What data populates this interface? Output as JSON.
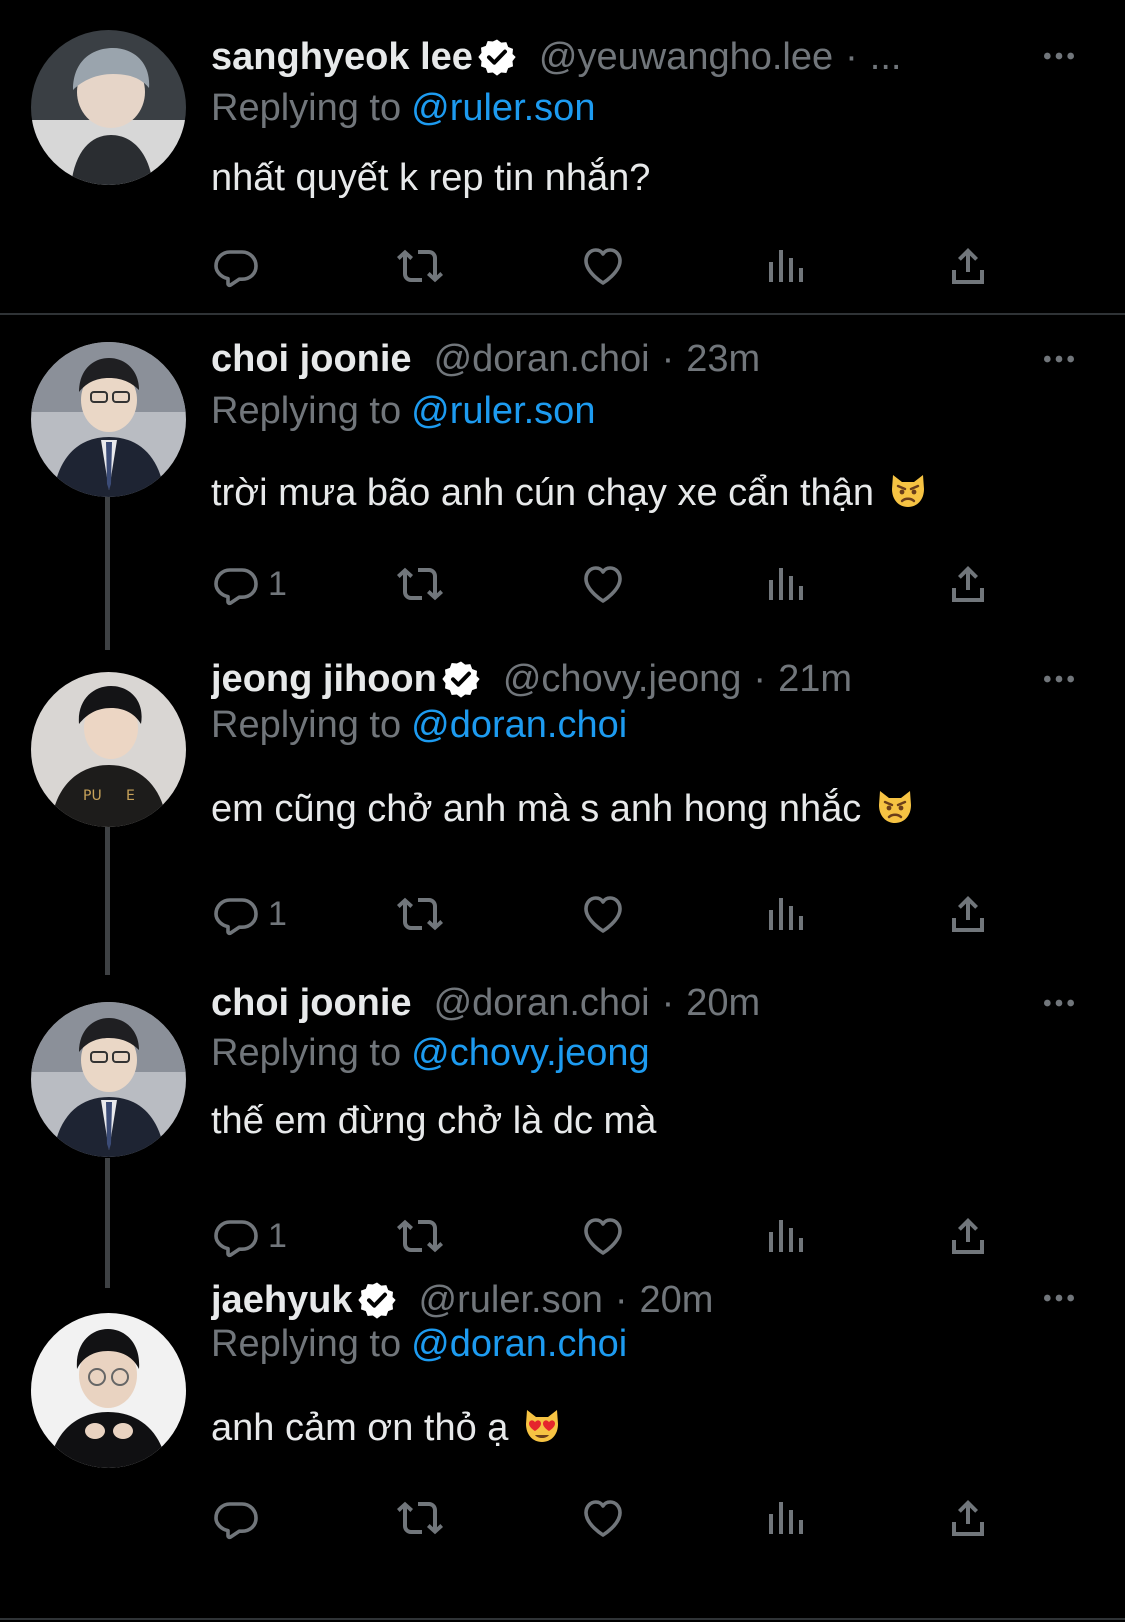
{
  "tweets": [
    {
      "display_name": "sanghyeok lee",
      "verified": true,
      "handle": "@yeuwangho.lee",
      "time": "...",
      "replying_label": "Replying to",
      "replying_to": "@ruler.son",
      "text": "nhất quyết k rep tin nhắn?",
      "emoji": "",
      "reply_count": ""
    },
    {
      "display_name": "choi joonie",
      "verified": false,
      "handle": "@doran.choi",
      "time": "23m",
      "replying_label": "Replying to",
      "replying_to": "@ruler.son",
      "text": "trời mưa bão anh cún chạy xe cẩn thận",
      "emoji": "pouting-cat-emoji",
      "reply_count": "1"
    },
    {
      "display_name": "jeong jihoon",
      "verified": true,
      "handle": "@chovy.jeong",
      "time": "21m",
      "replying_label": "Replying to",
      "replying_to": "@doran.choi",
      "text": "em cũng chở anh mà s anh hong nhắc",
      "emoji": "pouting-cat-emoji",
      "reply_count": "1"
    },
    {
      "display_name": "choi joonie",
      "verified": false,
      "handle": "@doran.choi",
      "time": "20m",
      "replying_label": "Replying to",
      "replying_to": "@chovy.jeong",
      "text": "thế em đừng chở là dc mà",
      "emoji": "",
      "reply_count": "1"
    },
    {
      "display_name": "jaehyuk",
      "verified": true,
      "handle": "@ruler.son",
      "time": "20m",
      "replying_label": "Replying to",
      "replying_to": "@doran.choi",
      "text": "anh cảm ơn thỏ ạ",
      "emoji": "heart-eyes-cat-emoji",
      "reply_count": ""
    }
  ],
  "colors": {
    "background": "#000000",
    "text": "#e7e9ea",
    "muted": "#71767b",
    "link": "#1d9bf0",
    "divider": "#2f3336",
    "thread_line": "#3e4144"
  },
  "icons": [
    "reply-icon",
    "retweet-icon",
    "like-icon",
    "views-icon",
    "share-icon",
    "more-icon",
    "verified-badge-icon"
  ]
}
